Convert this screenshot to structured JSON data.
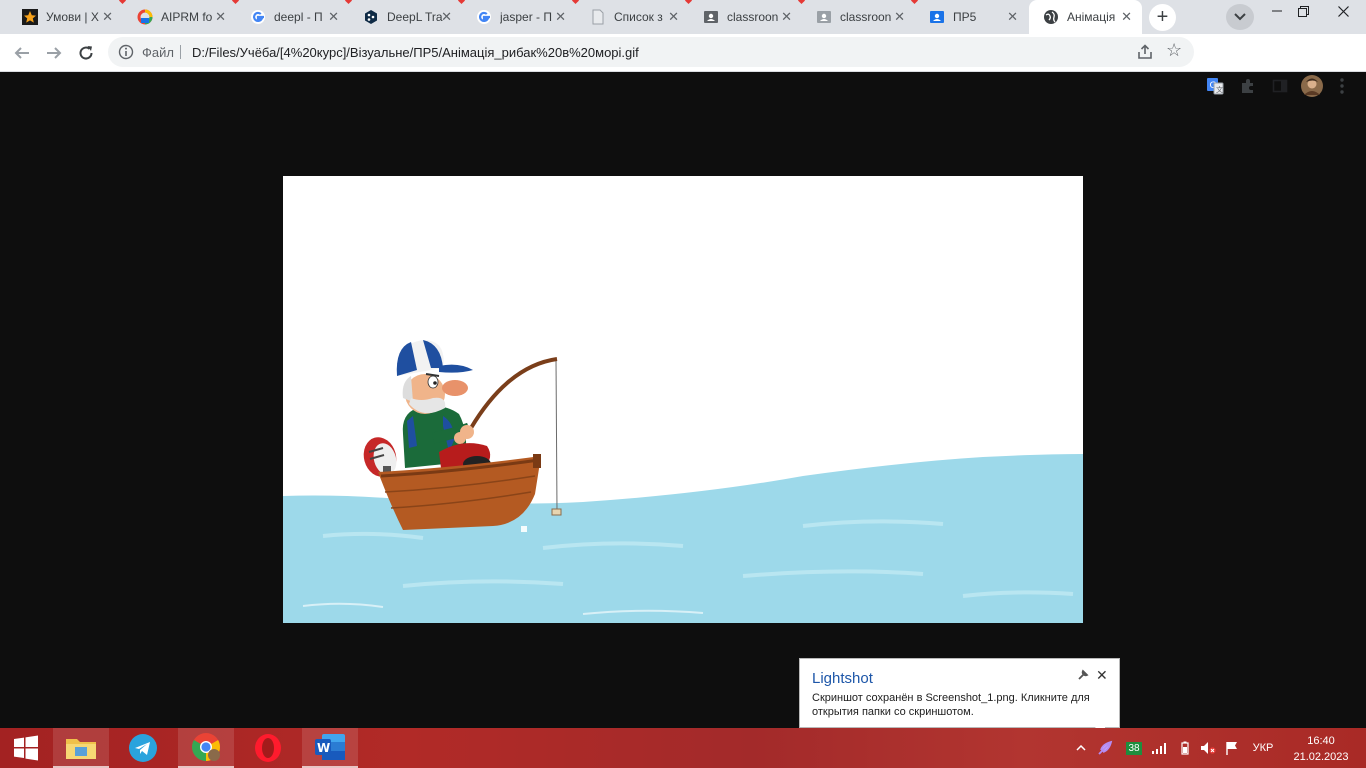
{
  "browser": {
    "tabs": [
      {
        "title": "Умови | Х",
        "favicon": "star-icon",
        "active": false
      },
      {
        "title": "AIPRM fo",
        "favicon": "aiprm-icon",
        "active": false
      },
      {
        "title": "deepl - П",
        "favicon": "google-icon",
        "active": false
      },
      {
        "title": "DeepL Tra",
        "favicon": "deepl-icon",
        "active": false
      },
      {
        "title": "jasper - П",
        "favicon": "google-icon",
        "active": false
      },
      {
        "title": "Список з",
        "favicon": "document-icon",
        "active": false
      },
      {
        "title": "classroon",
        "favicon": "classroom-icon",
        "active": false
      },
      {
        "title": "classroon",
        "favicon": "classroom-icon",
        "active": false
      },
      {
        "title": "ПР5",
        "favicon": "slides-icon",
        "active": false
      },
      {
        "title": "Анімація",
        "favicon": "globe-icon",
        "active": true
      }
    ],
    "new_tab_label": "+",
    "address_bar": {
      "scheme_label": "Файл",
      "url": "D:/Files/Учёба/[4%20курс]/Візуальне/ПР5/Анімація_рибак%20в%20морі.gif"
    }
  },
  "content": {
    "image_name": "Анімація_рибак в морі.gif",
    "scene": "fisherman-in-boat",
    "colors": {
      "sea": "#9dd9ea",
      "boat": "#b45a22",
      "cap": "#1f4fa0",
      "shirt": "#1b6b3a"
    }
  },
  "notification": {
    "title": "Lightshot",
    "body": "Скриншот сохранён в Screenshot_1.png. Кликните для открытия папки со скриншотом."
  },
  "taskbar": {
    "apps": [
      {
        "name": "start-button",
        "icon": "windows-icon"
      },
      {
        "name": "file-explorer-button",
        "icon": "folder-icon"
      },
      {
        "name": "telegram-button",
        "icon": "telegram-icon"
      },
      {
        "name": "chrome-button",
        "icon": "chrome-icon"
      },
      {
        "name": "opera-button",
        "icon": "opera-icon"
      },
      {
        "name": "word-button",
        "icon": "word-icon"
      }
    ],
    "tray": {
      "badge_count": "38",
      "language": "УКР",
      "time": "16:40",
      "date": "21.02.2023"
    }
  }
}
